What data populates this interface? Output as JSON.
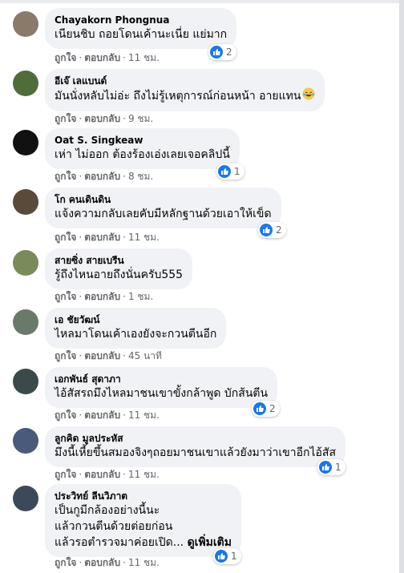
{
  "comments": [
    {
      "name": "Chayakorn Phongnua",
      "lines": [
        "เนียนชิบ ถอยโดนเค้านะเนี่ย แย่มาก"
      ],
      "like": "ถูกใจ",
      "reply": "ตอบกลับ",
      "time": "11 ชม.",
      "reactions": "2",
      "avatar_color": "#8a7a6a"
    },
    {
      "name": "อีเจ๊ เลแบนด์",
      "lines": [
        "มันนั่งหลับไม่อ่ะ ถึงไม่รู้เหตุการณ์ก่อนหน้า อายแทน"
      ],
      "like": "ถูกใจ",
      "reply": "ตอบกลับ",
      "time": "9 ชม.",
      "reactions": "",
      "avatar_color": "#4f6d3a"
    },
    {
      "name": "Oat S. Singkeaw",
      "lines": [
        "เห่า ไม่ออก ต้องร้องเอ่งเลยเจอคลิปนี้"
      ],
      "like": "ถูกใจ",
      "reply": "ตอบกลับ",
      "time": "8 ชม.",
      "reactions": "1",
      "avatar_color": "#111111"
    },
    {
      "name": "โก คนเดินดิน",
      "lines": [
        "แจ้งความกลับเลยคับมีหลักฐานด้วยเอาให้เข็ด"
      ],
      "like": "ถูกใจ",
      "reply": "ตอบกลับ",
      "time": "11 ชม.",
      "reactions": "2",
      "avatar_color": "#5a4a3a"
    },
    {
      "name": "สายซิ่ง สายเบรีน",
      "lines": [
        "รู้ถึงไหนอายถึงนั่นครับ555"
      ],
      "like": "ถูกใจ",
      "reply": "ตอบกลับ",
      "time": "1 ชม.",
      "reactions": "",
      "avatar_color": "#7a8a5a"
    },
    {
      "name": "เอ ชัยวัฒน์",
      "lines": [
        "ไหลมาโดนเค้าเองยังจะกวนตีนอีก"
      ],
      "like": "ถูกใจ",
      "reply": "ตอบกลับ",
      "time": "45 นาที",
      "reactions": "",
      "avatar_color": "#6a7a6a"
    },
    {
      "name": "เอกพันธ์ สุดาภา",
      "lines": [
        "ไอ้สัสรถมึงไหลมาชนเขาขั้งกล้าพูด บักส้นตีน"
      ],
      "like": "ถูกใจ",
      "reply": "ตอบกลับ",
      "time": "11 ชม.",
      "reactions": "2",
      "avatar_color": "#3a4a4a"
    },
    {
      "name": "ลูกคิด มูลประหัส",
      "lines": [
        "มึงนี้เหี้ยขึ้นสมองจิงๆถอยมาชนเขาแล้วยังมาว่าเขาอีกไอ้สัส"
      ],
      "like": "ถูกใจ",
      "reply": "ตอบกลับ",
      "time": "11 ชม.",
      "reactions": "1",
      "avatar_color": "#4a5a7a"
    },
    {
      "name": "ประวิทย์ ลีนวิภาต",
      "lines": [
        "เป็นกูมีกล้องอย่างนี้นะ",
        "แล้วกวนตีนด้วยต่อยก่อน",
        "แล้วรอตำรวจมาค่อยเปิด..."
      ],
      "see_more": "ดูเพิ่มเติม",
      "like": "ถูกใจ",
      "reply": "ตอบกลับ",
      "time": "11 ชม.",
      "reactions": "1",
      "avatar_color": "#3a4a5a"
    }
  ],
  "separator": "·",
  "colors": {
    "bubble": "#f0f2f5",
    "like_blue": "#1877f2",
    "meta": "#65676b"
  }
}
